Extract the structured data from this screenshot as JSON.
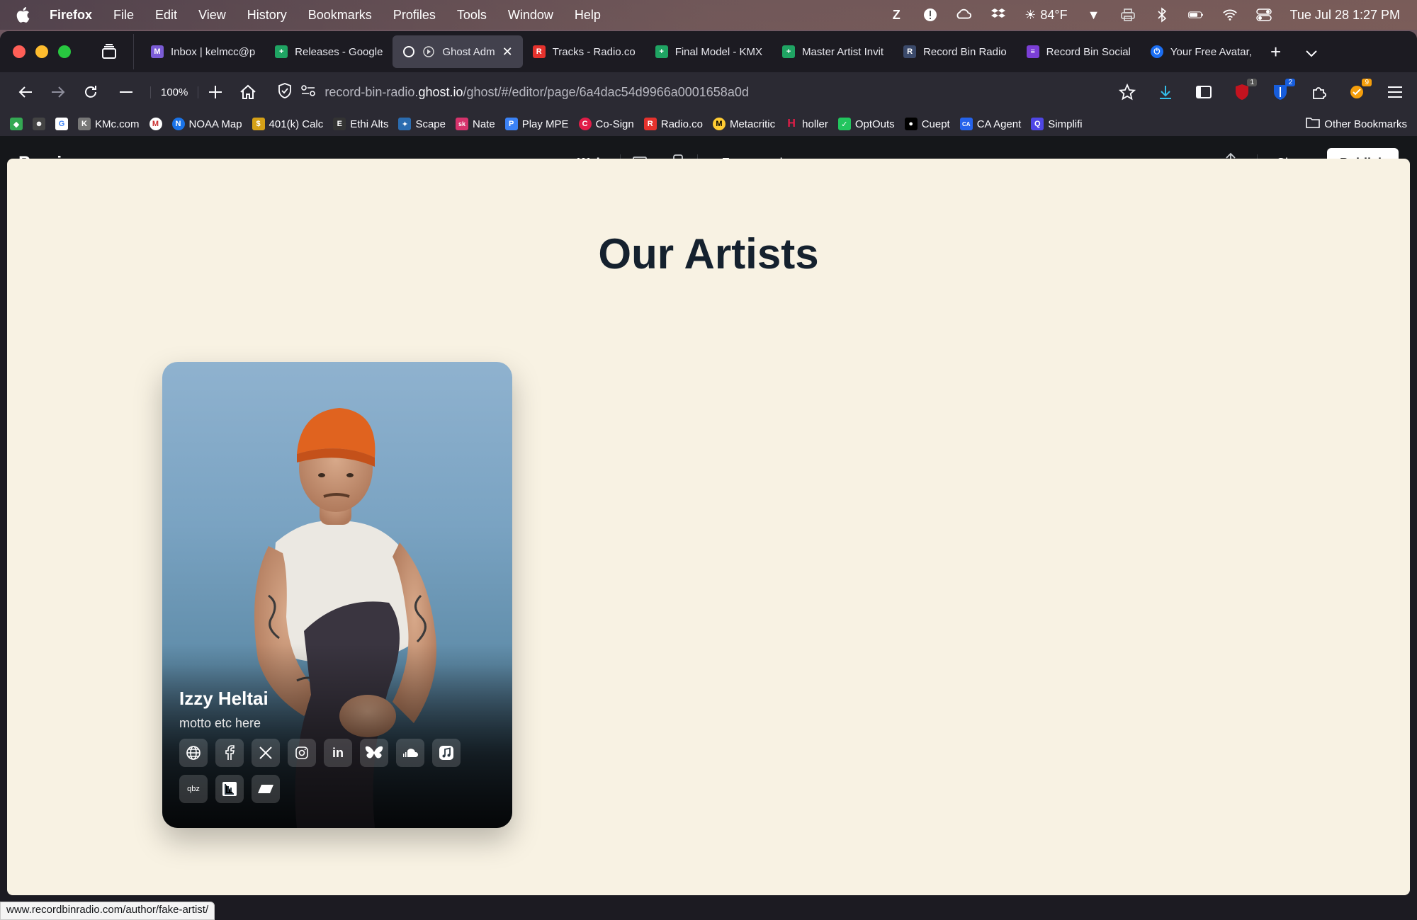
{
  "menubar": {
    "app": "Firefox",
    "items": [
      "File",
      "Edit",
      "View",
      "History",
      "Bookmarks",
      "Profiles",
      "Tools",
      "Window",
      "Help"
    ],
    "weather": "84°F",
    "datetime": "Tue Jul 28  1:27 PM"
  },
  "tabs": [
    {
      "title": "Inbox | kelmcc@p",
      "color": "#7b5cd6",
      "icon_letter": "M"
    },
    {
      "title": "Releases - Google",
      "color": "#1fa463",
      "icon_letter": "+"
    },
    {
      "title": "Ghost Adm",
      "color": "#15171a",
      "icon_letter": "◯",
      "active": true
    },
    {
      "title": "Tracks - Radio.co",
      "color": "#e5322d",
      "icon_letter": "R"
    },
    {
      "title": "Final Model - KMX",
      "color": "#1fa463",
      "icon_letter": "+"
    },
    {
      "title": "Master Artist Invit",
      "color": "#1fa463",
      "icon_letter": "+"
    },
    {
      "title": "Record Bin Radio",
      "color": "#3b4a6b",
      "icon_letter": "R"
    },
    {
      "title": "Record Bin Social",
      "color": "#7b3fd6",
      "icon_letter": "≡"
    },
    {
      "title": "Your Free Avatar,",
      "color": "#1b6ef3",
      "icon_letter": "⏻"
    }
  ],
  "navbar": {
    "zoom": "100%",
    "url_prefix": "record-bin-radio.",
    "url_host": "ghost.io",
    "url_path": "/ghost/#/editor/page/6a4dac54d9966a0001658a0d"
  },
  "bookmarks": [
    {
      "label": "",
      "color": "#34a853",
      "icon_letter": "◆"
    },
    {
      "label": "",
      "color": "#444",
      "icon_letter": "☻"
    },
    {
      "label": "",
      "color": "#fff",
      "icon_letter": "G"
    },
    {
      "label": "KMc.com",
      "color": "#777",
      "icon_letter": "K"
    },
    {
      "label": "",
      "color": "#c33",
      "icon_letter": "M"
    },
    {
      "label": "NOAA Map",
      "color": "#1a73e8",
      "icon_letter": "N"
    },
    {
      "label": "401(k) Calc",
      "color": "#d4a017",
      "icon_letter": "$"
    },
    {
      "label": "Ethi Alts",
      "color": "#333",
      "icon_letter": "E"
    },
    {
      "label": "Scape",
      "color": "#2b6cb0",
      "icon_letter": "✦"
    },
    {
      "label": "Nate",
      "color": "#d6336c",
      "icon_letter": "sk"
    },
    {
      "label": "Play MPE",
      "color": "#3b82f6",
      "icon_letter": "P"
    },
    {
      "label": "Co-Sign",
      "color": "#e11d48",
      "icon_letter": "C"
    },
    {
      "label": "Radio.co",
      "color": "#e5322d",
      "icon_letter": "R"
    },
    {
      "label": "Metacritic",
      "color": "#ffcc33",
      "icon_letter": "M"
    },
    {
      "label": "holler",
      "color": "#e11d48",
      "icon_letter": "H"
    },
    {
      "label": "OptOuts",
      "color": "#22c55e",
      "icon_letter": "✓"
    },
    {
      "label": "Cuept",
      "color": "#000",
      "icon_letter": "●"
    },
    {
      "label": "CA Agent",
      "color": "#2563eb",
      "icon_letter": "CA"
    },
    {
      "label": "Simplifi",
      "color": "#4f46e5",
      "icon_letter": "Q"
    },
    {
      "label": "Other Bookmarks",
      "color": "transparent",
      "icon_letter": "▭"
    }
  ],
  "preview_bar": {
    "title": "Preview",
    "mode_web": "Web",
    "member": "Free member",
    "close": "Close",
    "publish": "Publish"
  },
  "page": {
    "heading": "Our Artists",
    "artist": {
      "name": "Izzy Heltai",
      "motto": "motto etc here",
      "socials": [
        "globe-icon",
        "facebook-icon",
        "x-icon",
        "instagram-icon",
        "linkedin-icon",
        "bluesky-icon",
        "soundcloud-icon",
        "apple-music-icon",
        "qobuz-icon",
        "bandcamp-icon",
        "tidal-icon"
      ],
      "qobuz_label": "qbz"
    }
  },
  "status_url": "www.recordbinradio.com/author/fake-artist/"
}
